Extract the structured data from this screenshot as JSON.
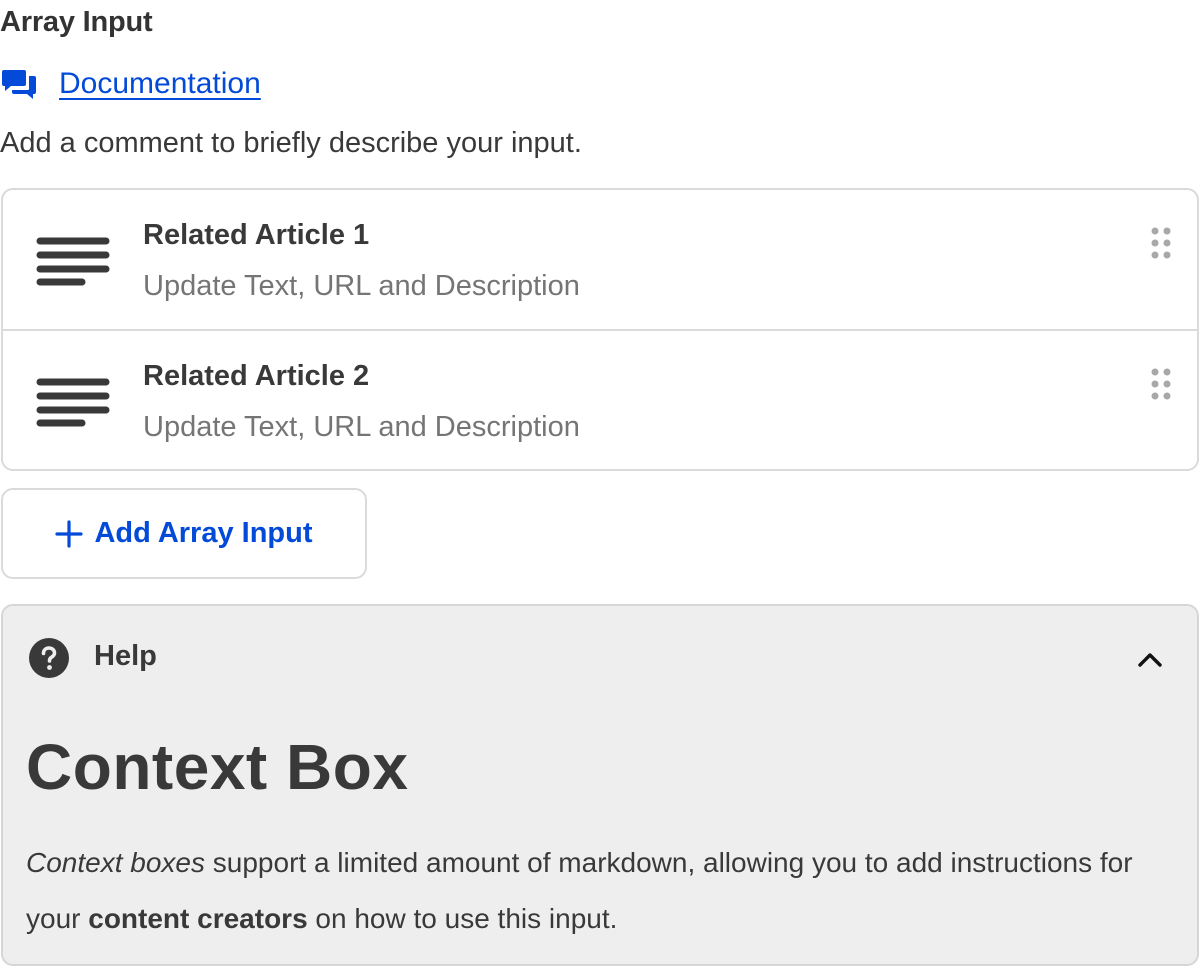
{
  "header": {
    "title": "Array Input",
    "documentation_link": "Documentation",
    "comment": "Add a comment to briefly describe your input."
  },
  "array_items": [
    {
      "title": "Related Article 1",
      "subtitle": "Update Text, URL and Description",
      "icon": "lines-icon"
    },
    {
      "title": "Related Article 2",
      "subtitle": "Update Text, URL and Description",
      "icon": "lines-icon"
    }
  ],
  "add_button": {
    "label": "Add Array Input",
    "icon": "plus-icon"
  },
  "help": {
    "label": "Help",
    "heading": "Context Box",
    "text_italic": "Context boxes",
    "text_part1": " support a limited amount of markdown, allowing you to add instructions for your ",
    "text_bold": "content creators",
    "text_part2": " on how to use this input."
  },
  "colors": {
    "link_blue": "#034ad8",
    "text": "#393939",
    "muted": "#757575",
    "border": "#dadada",
    "help_bg": "#eeeeee"
  }
}
